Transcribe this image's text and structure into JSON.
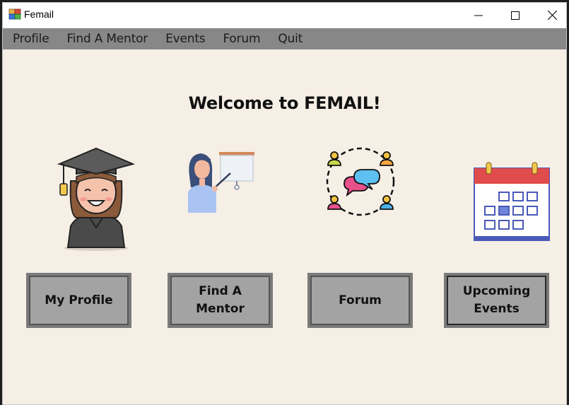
{
  "window": {
    "title": "Femail"
  },
  "menu": [
    "Profile",
    "Find A Mentor",
    "Events",
    "Forum",
    "Quit"
  ],
  "main": {
    "heading": "Welcome to FEMAIL!",
    "buttons": {
      "profile": "My Profile",
      "mentor": "Find A Mentor",
      "forum": "Forum",
      "events": "Upcoming Events"
    }
  },
  "icons": {
    "app": "app-icon",
    "graduate": "graduate-icon",
    "mentor": "teacher-whiteboard-icon",
    "forum": "community-chat-icon",
    "calendar": "calendar-icon"
  },
  "colors": {
    "background": "#f6efe6",
    "menubar": "#878787",
    "button": "#a3a3a3"
  }
}
